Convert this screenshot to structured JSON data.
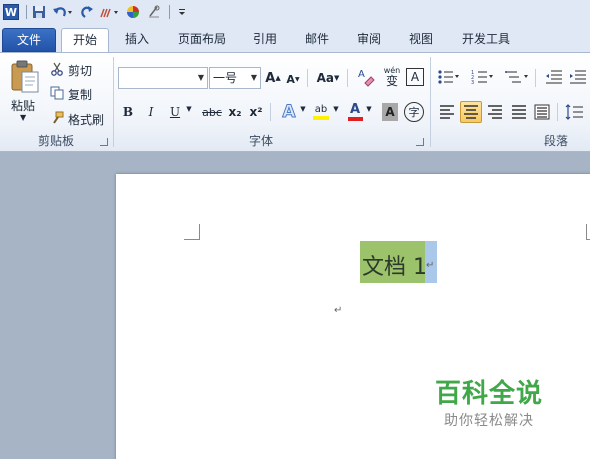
{
  "quick_access": {
    "app_icon": "word-app-icon",
    "items": [
      "save-icon",
      "undo-icon",
      "redo-icon",
      "format-painter-icon",
      "color-wheel-icon",
      "clear-format-icon",
      "customize-toolbar-icon"
    ]
  },
  "tabs": [
    "文件",
    "开始",
    "插入",
    "页面布局",
    "引用",
    "邮件",
    "审阅",
    "视图",
    "开发工具"
  ],
  "active_tab": "开始",
  "ribbon": {
    "clipboard": {
      "label": "剪贴板",
      "paste": "粘贴",
      "cut": "剪切",
      "copy": "复制",
      "format_painter": "格式刷"
    },
    "font": {
      "label": "字体",
      "font_name": "",
      "font_size": "一号",
      "grow": "A",
      "shrink": "A",
      "change_case": "Aa",
      "clear_format": "A",
      "phonetic": "wén",
      "phonetic_char": "变",
      "char_border": "A",
      "bold": "B",
      "italic": "I",
      "underline": "U",
      "strikethrough": "abc",
      "subscript": "x₂",
      "superscript": "x²",
      "text_effects": "A",
      "highlight": "ab",
      "font_color": "A",
      "char_shading": "A",
      "enclose_char": "字"
    },
    "paragraph": {
      "label": "段落"
    }
  },
  "document": {
    "title_text": "文档 1",
    "paragraph_mark": "↵"
  },
  "watermark": {
    "brand": "百科全说",
    "slogan": "助你轻松解决"
  },
  "colors": {
    "highlight_green": "#9cc26b",
    "selection_blue": "#a9c8ea",
    "file_tab": "#2b5ba8",
    "font_color_red": "#e02020",
    "highlight_yellow": "#fff200",
    "watermark_green": "#40a848"
  }
}
